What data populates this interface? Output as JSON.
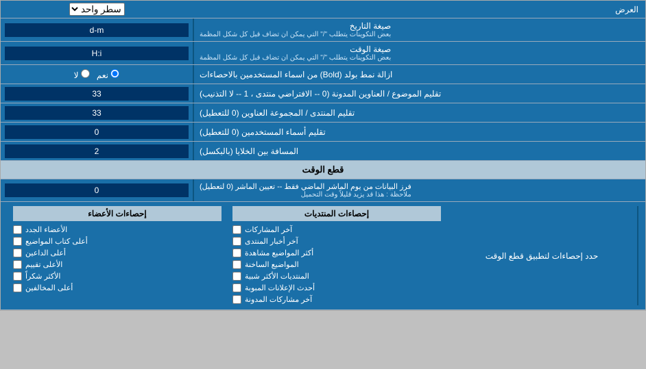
{
  "title": "العرض",
  "rows": [
    {
      "id": "top",
      "label": "العرض",
      "input_type": "select",
      "value": "سطر واحد"
    },
    {
      "id": "date_format",
      "label": "صيغة التاريخ",
      "label_small": "بعض التكوينات يتطلب \"/\" التي يمكن ان تضاف قبل كل شكل المظمة",
      "input_type": "text",
      "value": "d-m"
    },
    {
      "id": "time_format",
      "label": "صيغة الوقت",
      "label_small": "بعض التكوينات يتطلب \"/\" التي يمكن ان تضاف قبل كل شكل المظمة",
      "input_type": "text",
      "value": "H:i"
    },
    {
      "id": "bold_remove",
      "label": "ازالة نمط بولد (Bold) من اسماء المستخدمين بالاحصاءات",
      "input_type": "radio",
      "radio_options": [
        "نعم",
        "لا"
      ],
      "selected": "نعم"
    },
    {
      "id": "topic_order",
      "label": "تقليم الموضوع / العناوين المدونة (0 -- الافتراضي منتدى ، 1 -- لا التذنيب)",
      "input_type": "text",
      "value": "33"
    },
    {
      "id": "forum_order",
      "label": "تقليم المنتدى / المجموعة العناوين (0 للتعطيل)",
      "input_type": "text",
      "value": "33"
    },
    {
      "id": "username_trim",
      "label": "تقليم أسماء المستخدمين (0 للتعطيل)",
      "input_type": "text",
      "value": "0"
    },
    {
      "id": "cell_padding",
      "label": "المسافة بين الخلايا (بالبكسل)",
      "input_type": "text",
      "value": "2"
    }
  ],
  "section_realtime": {
    "title": "قطع الوقت",
    "row": {
      "label": "فرز البيانات من يوم الماشر الماضي فقط -- تعيين الماشر (0 لتعطيل)\nملاحظة : هذا قد يزيد قليلاً وقت التحميل",
      "input_type": "text",
      "value": "0"
    },
    "filter_label": "حدد إحصاءات لتطبيق قطع الوقت"
  },
  "checkboxes": {
    "col1_header": "إحصاءات المنتديات",
    "col1_items": [
      "آخر المشاركات",
      "آخر أخبار المنتدى",
      "أكثر المواضيع مشاهدة",
      "المواضيع الساخنة",
      "المنتديات الأكثر شبية",
      "أحدث الإعلانات المبوبة",
      "آخر مشاركات المدونة"
    ],
    "col2_header": "إحصاءات الأعضاء",
    "col2_items": [
      "الأعضاء الجدد",
      "أعلى كتاب المواضيع",
      "أعلى الداعين",
      "الأعلى تقييم",
      "الأكثر شكراً",
      "أعلى المخالفين"
    ]
  }
}
